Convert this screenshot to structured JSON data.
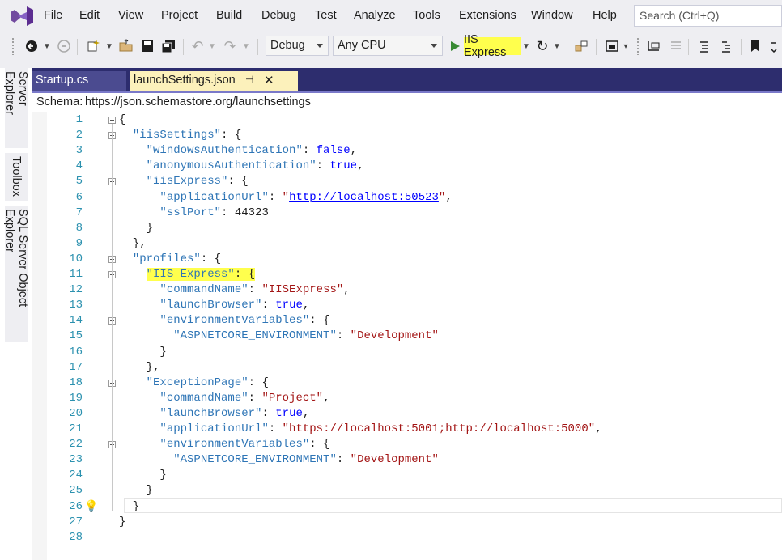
{
  "menu": {
    "items": [
      "File",
      "Edit",
      "View",
      "Project",
      "Build",
      "Debug",
      "Test",
      "Analyze",
      "Tools",
      "Extensions",
      "Window",
      "Help"
    ],
    "search_placeholder": "Search (Ctrl+Q)"
  },
  "toolbar": {
    "config": "Debug",
    "platform": "Any CPU",
    "run_target": "IIS Express",
    "accent": "#ffff4d"
  },
  "side_tabs": [
    "Server Explorer",
    "Toolbox",
    "SQL Server Object Explorer"
  ],
  "tabs": [
    {
      "label": "Startup.cs",
      "active": false
    },
    {
      "label": "launchSettings.json",
      "active": true,
      "pin": "⊣",
      "close": "✕"
    }
  ],
  "schema": {
    "label": "Schema:",
    "url": "https://json.schemastore.org/launchsettings"
  },
  "code_lines": [
    {
      "n": "1",
      "t": "{"
    },
    {
      "n": "2",
      "t": "  \"iisSettings\": {"
    },
    {
      "n": "3",
      "t": "    \"windowsAuthentication\": false,"
    },
    {
      "n": "4",
      "t": "    \"anonymousAuthentication\": true,"
    },
    {
      "n": "5",
      "t": "    \"iisExpress\": {"
    },
    {
      "n": "6",
      "t": "      \"applicationUrl\": \"http://localhost:50523\","
    },
    {
      "n": "7",
      "t": "      \"sslPort\": 44323"
    },
    {
      "n": "8",
      "t": "    }"
    },
    {
      "n": "9",
      "t": "  },"
    },
    {
      "n": "10",
      "t": "  \"profiles\": {"
    },
    {
      "n": "11",
      "t": "    \"IIS Express\": {"
    },
    {
      "n": "12",
      "t": "      \"commandName\": \"IISExpress\","
    },
    {
      "n": "13",
      "t": "      \"launchBrowser\": true,"
    },
    {
      "n": "14",
      "t": "      \"environmentVariables\": {"
    },
    {
      "n": "15",
      "t": "        \"ASPNETCORE_ENVIRONMENT\": \"Development\""
    },
    {
      "n": "16",
      "t": "      }"
    },
    {
      "n": "17",
      "t": "    },"
    },
    {
      "n": "18",
      "t": "    \"ExceptionPage\": {"
    },
    {
      "n": "19",
      "t": "      \"commandName\": \"Project\","
    },
    {
      "n": "20",
      "t": "      \"launchBrowser\": true,"
    },
    {
      "n": "21",
      "t": "      \"applicationUrl\": \"https://localhost:5001;http://localhost:5000\","
    },
    {
      "n": "22",
      "t": "      \"environmentVariables\": {"
    },
    {
      "n": "23",
      "t": "        \"ASPNETCORE_ENVIRONMENT\": \"Development\""
    },
    {
      "n": "24",
      "t": "      }"
    },
    {
      "n": "25",
      "t": "    }"
    },
    {
      "n": "26",
      "t": "  }"
    },
    {
      "n": "27",
      "t": "}"
    },
    {
      "n": "28",
      "t": ""
    }
  ],
  "highlight_text": "\"IIS Express\": {",
  "colors": {
    "tabstrip": "#2d2d6e",
    "active_tab": "#fcf1bb",
    "line_numbers": "#2b91af",
    "json_key": "#2e75b6",
    "json_string": "#a31515",
    "json_keyword": "#0000ff",
    "highlight": "#ffff4d"
  }
}
